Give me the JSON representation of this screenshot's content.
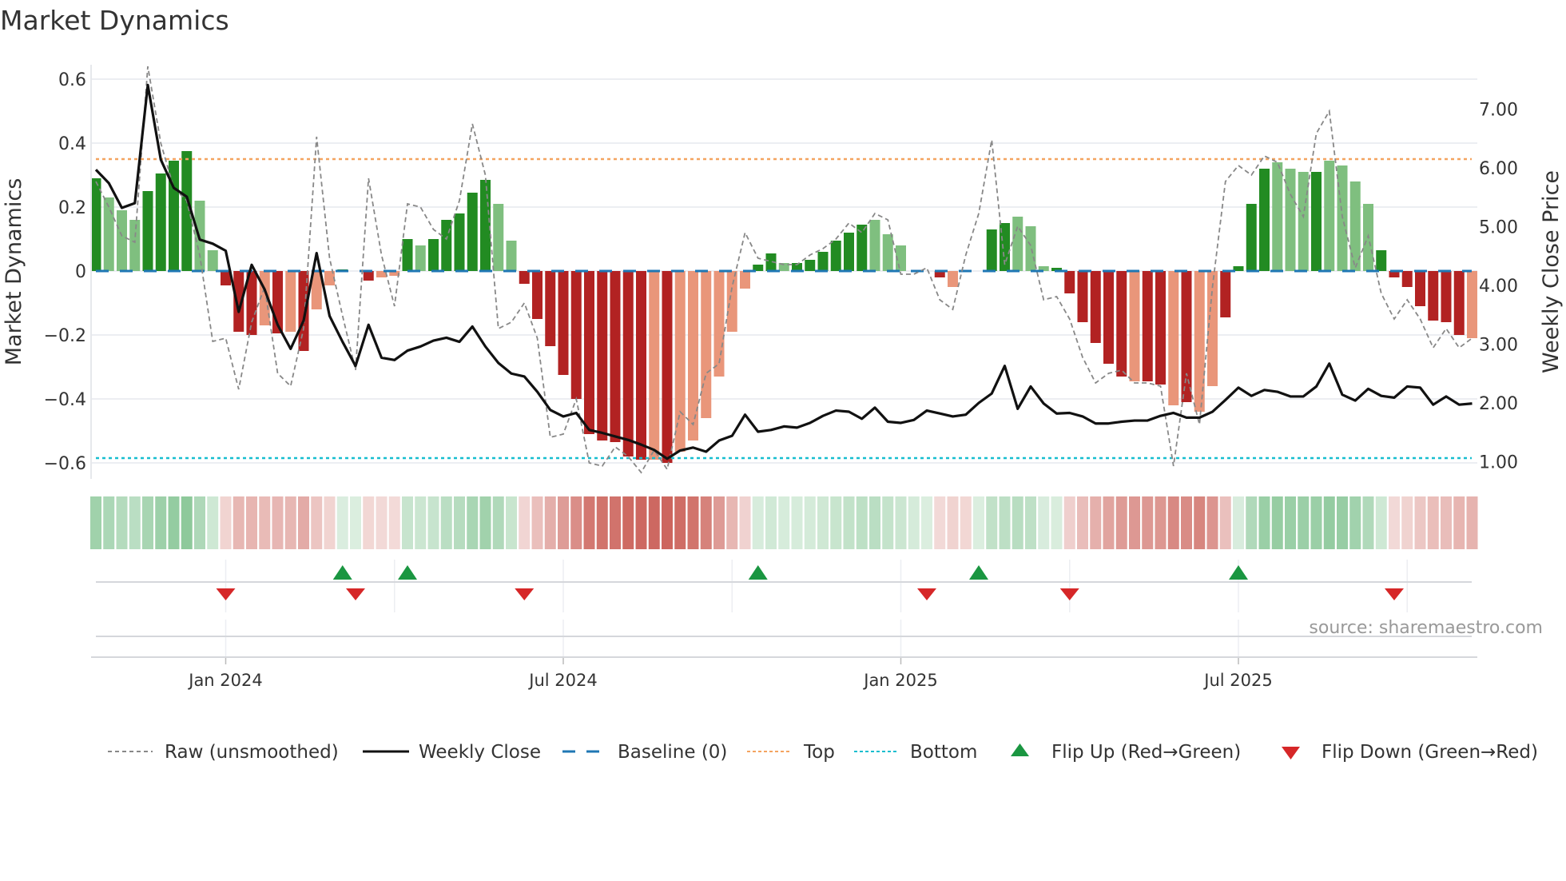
{
  "title": "Market Dynamics",
  "source": "source: sharemaestro.com",
  "colors": {
    "dark_green": "#228b22",
    "light_green": "#7fbf7f",
    "dark_red": "#b22222",
    "light_red": "#e9967a",
    "raw": "#888888",
    "close": "#111111",
    "baseline": "#1f77b4",
    "top": "#f4a460",
    "bottom": "#17becf",
    "flip_up": "#1a9641",
    "flip_down": "#d62728"
  },
  "chart_data": {
    "type": "bar",
    "title": "Market Dynamics",
    "ylabel": "Market Dynamics",
    "ylabel_right": "Weekly Close Price",
    "ylim": [
      -0.65,
      0.66
    ],
    "ylim_right": [
      0.7,
      7.9
    ],
    "yticks": [
      "0.6",
      "0.4",
      "0.2",
      "0",
      "−0.2",
      "−0.4",
      "−0.6"
    ],
    "ytick_values": [
      0.6,
      0.4,
      0.2,
      0,
      -0.2,
      -0.4,
      -0.6
    ],
    "yticks_right": [
      "7.00",
      "6.00",
      "5.00",
      "4.00",
      "3.00",
      "2.00",
      "1.00"
    ],
    "ytick_right_values": [
      7,
      6,
      5,
      4,
      3,
      2,
      1
    ],
    "x_unit": "week index",
    "xticks": [
      {
        "label": "Jan 2024",
        "x": 10
      },
      {
        "label": "Jul 2024",
        "x": 36
      },
      {
        "label": "Jan 2025",
        "x": 62
      },
      {
        "label": "Jul 2025",
        "x": 88
      }
    ],
    "minor_xticks": [
      23,
      49,
      75,
      101
    ],
    "top_level": 0.35,
    "bottom_level": -0.585,
    "baseline": 0,
    "dynamics": [
      0.29,
      0.23,
      0.19,
      0.16,
      0.25,
      0.305,
      0.345,
      0.375,
      0.22,
      0.065,
      -0.045,
      -0.19,
      -0.2,
      -0.17,
      -0.195,
      -0.19,
      -0.25,
      -0.12,
      -0.045,
      0.005,
      0,
      -0.03,
      -0.02,
      -0.015,
      0.1,
      0.08,
      0.1,
      0.16,
      0.18,
      0.245,
      0.285,
      0.21,
      0.095,
      -0.04,
      -0.15,
      -0.235,
      -0.325,
      -0.4,
      -0.51,
      -0.53,
      -0.535,
      -0.58,
      -0.59,
      -0.59,
      -0.6,
      -0.565,
      -0.53,
      -0.46,
      -0.33,
      -0.19,
      -0.055,
      0.02,
      0.055,
      0.025,
      0.025,
      0.035,
      0.06,
      0.095,
      0.12,
      0.145,
      0.16,
      0.115,
      0.08,
      0.03,
      0,
      -0.02,
      -0.05,
      -0.03,
      0,
      0.13,
      0.15,
      0.17,
      0.14,
      0.015,
      0.01,
      -0.07,
      -0.16,
      -0.225,
      -0.29,
      -0.33,
      -0.345,
      -0.345,
      -0.355,
      -0.42,
      -0.41,
      -0.44,
      -0.36,
      -0.145,
      0.015,
      0.21,
      0.32,
      0.34,
      0.32,
      0.31,
      0.31,
      0.345,
      0.33,
      0.28,
      0.21,
      0.065,
      -0.02,
      -0.05,
      -0.11,
      -0.155,
      -0.16,
      -0.2,
      -0.21
    ],
    "shade": "DLLLDDDDLLDDDLDLDLLD_DLLDLDDDDDLLDDDDDDDDDDLDLLLLLLDDLDDDDDDLLL_DDL_DDDLLLDDDDDDLDDLDLLDDDDLLLDLLLLDDDDDDD",
    "raw": [
      0.28,
      0.2,
      0.11,
      0.09,
      0.64,
      0.4,
      0.26,
      0.22,
      0.05,
      -0.22,
      -0.21,
      -0.37,
      -0.16,
      -0.05,
      -0.32,
      -0.36,
      -0.18,
      0.42,
      0.04,
      -0.14,
      -0.31,
      0.29,
      0.05,
      -0.11,
      0.21,
      0.2,
      0.13,
      0.1,
      0.22,
      0.46,
      0.3,
      -0.18,
      -0.16,
      -0.1,
      -0.21,
      -0.52,
      -0.51,
      -0.4,
      -0.6,
      -0.61,
      -0.55,
      -0.58,
      -0.63,
      -0.56,
      -0.62,
      -0.44,
      -0.48,
      -0.32,
      -0.29,
      -0.05,
      0.12,
      0.04,
      0.03,
      0.02,
      0.02,
      0.05,
      0.07,
      0.1,
      0.15,
      0.12,
      0.18,
      0.16,
      -0.01,
      -0.01,
      0.01,
      -0.09,
      -0.12,
      0.05,
      0.18,
      0.41,
      0.02,
      0.14,
      0.08,
      -0.09,
      -0.08,
      -0.15,
      -0.27,
      -0.35,
      -0.32,
      -0.31,
      -0.35,
      -0.35,
      -0.36,
      -0.61,
      -0.32,
      -0.48,
      -0.05,
      0.28,
      0.33,
      0.3,
      0.36,
      0.34,
      0.24,
      0.17,
      0.43,
      0.5,
      0.17,
      0.01,
      0.11,
      -0.07,
      -0.15,
      -0.09,
      -0.15,
      -0.24,
      -0.18,
      -0.24,
      -0.21
    ],
    "weekly_close": [
      5.97,
      5.74,
      5.32,
      5.4,
      7.41,
      6.14,
      5.66,
      5.51,
      4.78,
      4.71,
      4.59,
      3.55,
      4.35,
      3.93,
      3.33,
      2.92,
      3.4,
      4.55,
      3.48,
      3.04,
      2.63,
      3.33,
      2.77,
      2.73,
      2.89,
      2.96,
      3.06,
      3.11,
      3.04,
      3.3,
      2.96,
      2.68,
      2.5,
      2.45,
      2.19,
      1.88,
      1.77,
      1.83,
      1.54,
      1.49,
      1.43,
      1.37,
      1.29,
      1.2,
      1.05,
      1.19,
      1.24,
      1.17,
      1.36,
      1.44,
      1.8,
      1.51,
      1.54,
      1.6,
      1.58,
      1.66,
      1.78,
      1.87,
      1.85,
      1.73,
      1.92,
      1.68,
      1.66,
      1.71,
      1.87,
      1.82,
      1.77,
      1.8,
      2.0,
      2.16,
      2.63,
      1.9,
      2.28,
      1.99,
      1.82,
      1.83,
      1.77,
      1.65,
      1.65,
      1.68,
      1.7,
      1.7,
      1.78,
      1.83,
      1.75,
      1.75,
      1.85,
      2.05,
      2.26,
      2.12,
      2.22,
      2.19,
      2.11,
      2.11,
      2.28,
      2.67,
      2.14,
      2.04,
      2.24,
      2.12,
      2.09,
      2.28,
      2.26,
      1.97,
      2.11,
      1.97,
      1.99
    ],
    "flip_up": [
      19,
      24,
      51,
      68,
      88
    ],
    "flip_down": [
      10,
      20,
      33,
      64,
      75,
      100
    ],
    "legend_position": "bottom",
    "legend": [
      "Raw (unsmoothed)",
      "Weekly Close",
      "Baseline (0)",
      "Top",
      "Bottom",
      "Flip Up (Red→Green)",
      "Flip Down (Green→Red)"
    ]
  }
}
